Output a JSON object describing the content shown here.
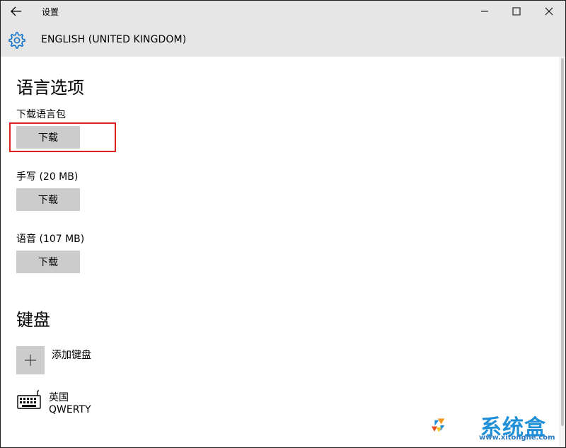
{
  "app": {
    "title": "设置",
    "page_title": "ENGLISH (UNITED KINGDOM)"
  },
  "window_controls": {
    "back": "back-arrow-icon",
    "minimize": "minimize-icon",
    "maximize": "maximize-icon",
    "close": "close-icon"
  },
  "language_options": {
    "heading": "语言选项",
    "items": [
      {
        "label": "下载语言包",
        "button": "下载"
      },
      {
        "label": "手写 (20 MB)",
        "button": "下载"
      },
      {
        "label": "语音 (107 MB)",
        "button": "下载"
      }
    ]
  },
  "keyboards": {
    "heading": "键盘",
    "add_label": "添加键盘",
    "installed": [
      {
        "name": "英国",
        "layout": "QWERTY"
      }
    ]
  },
  "colors": {
    "header_bg": "#e6e6e6",
    "button_bg": "#cccccc",
    "highlight": "#e0201e",
    "accent": "#0078d7"
  },
  "watermark": {
    "brand": "系统盒",
    "url": "www.xitonghe.com"
  }
}
